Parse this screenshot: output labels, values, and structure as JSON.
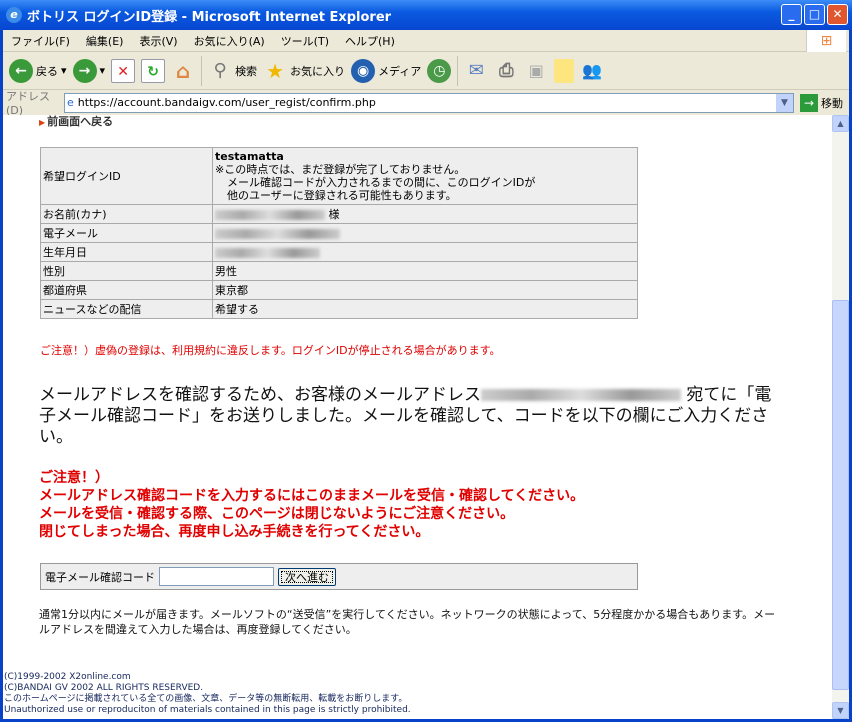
{
  "window": {
    "title": "ボトリス ログインID登録 - Microsoft Internet Explorer"
  },
  "menu": [
    "ファイル(F)",
    "編集(E)",
    "表示(V)",
    "お気に入り(A)",
    "ツール(T)",
    "ヘルプ(H)"
  ],
  "toolbar": {
    "back": "戻る",
    "search": "検索",
    "favorites": "お気に入り",
    "media": "メディア"
  },
  "address": {
    "label": "アドレス(D)",
    "url": "https://account.bandaigv.com/user_regist/confirm.php",
    "go": "移動"
  },
  "page": {
    "back_link": "前画面へ戻る",
    "table": [
      {
        "label": "希望ログインID",
        "value": "testamatta",
        "notes": [
          "※この時点では、まだ登録が完了しておりません。",
          "メール確認コードが入力されるまでの間に、このログインIDが",
          "他のユーザーに登録される可能性もあります。"
        ]
      },
      {
        "label": "お名前(カナ)",
        "value": "様"
      },
      {
        "label": "電子メール",
        "value": ""
      },
      {
        "label": "生年月日",
        "value": ""
      },
      {
        "label": "性別",
        "value": "男性"
      },
      {
        "label": "都道府県",
        "value": "東京都"
      },
      {
        "label": "ニュースなどの配信",
        "value": "希望する"
      }
    ],
    "warning1": "ご注意！）虚偽の登録は、利用規約に違反します。ログインIDが停止される場合があります。",
    "message_a": "メールアドレスを確認するため、お客様のメールアドレス",
    "message_b": "宛てに「電子メール確認コード」をお送りしました。メールを確認して、コードを以下の欄にご入力ください。",
    "warning2": [
      "ご注意！）",
      "メールアドレス確認コードを入力するにはこのままメールを受信・確認してください。",
      "メールを受信・確認する際、このページは閉じないようにご注意ください。",
      "閉じてしまった場合、再度申し込み手続きを行ってください。"
    ],
    "form": {
      "label": "電子メール確認コード",
      "button": "次へ進む"
    },
    "info": "通常1分以内にメールが届きます。メールソフトの“送受信”を実行してください。ネットワークの状態によって、5分程度かかる場合もあります。メールアドレスを間違えて入力した場合は、再度登録してください。",
    "footer": [
      "(C)1999-2002 X2online.com",
      "(C)BANDAI GV 2002 ALL RIGHTS RESERVED.",
      "このホームページに掲載されている全ての画像、文章、データ等の無断転用、転載をお断りします。",
      "Unauthorized use or reproduciton of materials contained in this page is strictly prohibited."
    ]
  }
}
